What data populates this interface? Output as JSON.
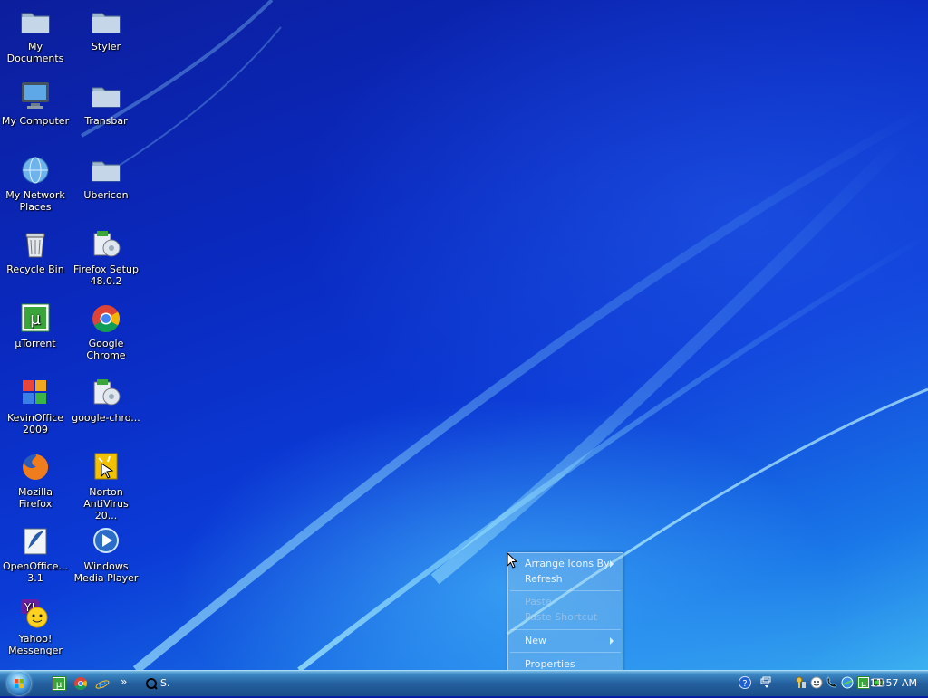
{
  "desktop": {
    "icons": [
      {
        "label": "My Documents"
      },
      {
        "label": "My Computer"
      },
      {
        "label": "My Network Places"
      },
      {
        "label": "Recycle Bin"
      },
      {
        "label": "µTorrent"
      },
      {
        "label": "KevinOffice 2009"
      },
      {
        "label": "Mozilla Firefox"
      },
      {
        "label": "OpenOffice... 3.1"
      },
      {
        "label": "Yahoo! Messenger"
      },
      {
        "label": "Styler"
      },
      {
        "label": "Transbar"
      },
      {
        "label": "Ubericon"
      },
      {
        "label": "Firefox Setup 48.0.2"
      },
      {
        "label": "Google Chrome"
      },
      {
        "label": "google-chro..."
      },
      {
        "label": "Norton AntiVirus 20..."
      },
      {
        "label": "Windows Media Player"
      }
    ]
  },
  "context_menu": {
    "arrange_icons_by": "Arrange Icons By",
    "refresh": "Refresh",
    "paste": "Paste",
    "paste_shortcut": "Paste Shortcut",
    "new": "New",
    "properties": "Properties"
  },
  "taskbar": {
    "quick_launch_more": "»",
    "task_label": "S.",
    "clock": "11:57 AM"
  },
  "colors": {
    "desktop_bg": "#0a2ac0",
    "taskbar": "#245f9e"
  }
}
